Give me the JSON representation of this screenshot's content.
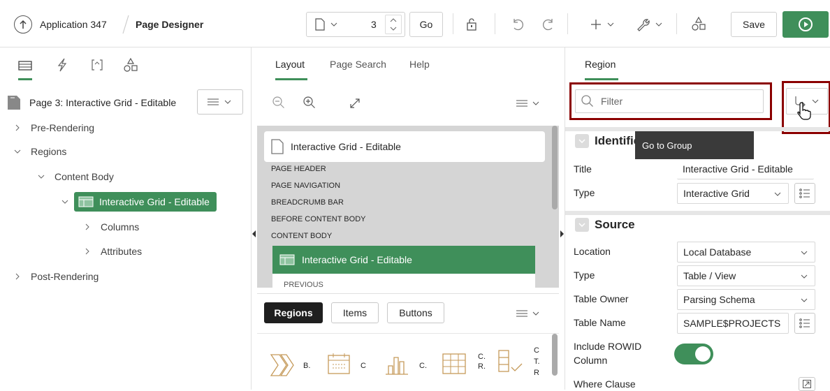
{
  "topbar": {
    "app_title": "Application 347",
    "page_title": "Page Designer",
    "page_number": "3",
    "go_label": "Go",
    "save_label": "Save"
  },
  "left": {
    "page_label": "Page 3: Interactive Grid - Editable",
    "tree": {
      "pre_rendering": "Pre-Rendering",
      "regions": "Regions",
      "content_body": "Content Body",
      "ig_region": "Interactive Grid - Editable",
      "columns": "Columns",
      "attributes": "Attributes",
      "post_rendering": "Post-Rendering"
    }
  },
  "middle": {
    "tabs": [
      "Layout",
      "Page Search",
      "Help"
    ],
    "page_card": "Interactive Grid - Editable",
    "positions": [
      "PAGE HEADER",
      "PAGE NAVIGATION",
      "BREADCRUMB BAR",
      "BEFORE CONTENT BODY",
      "CONTENT BODY"
    ],
    "region_block": "Interactive Grid - Editable",
    "previous_label": "PREVIOUS",
    "gallery_tabs": [
      "Regions",
      "Items",
      "Buttons"
    ],
    "gallery_labels": [
      "B.",
      "C",
      "C.",
      "C.\nR.",
      "C\nT.\nR"
    ]
  },
  "right": {
    "tab": "Region",
    "filter_placeholder": "Filter",
    "tooltip": "Go to Group",
    "identification_header": "Identific",
    "title_label": "Title",
    "title_value": "Interactive Grid - Editable",
    "type_label": "Type",
    "type_value": "Interactive Grid",
    "source_header": "Source",
    "location_label": "Location",
    "location_value": "Local Database",
    "source_type_label": "Type",
    "source_type_value": "Table / View",
    "table_owner_label": "Table Owner",
    "table_owner_value": "Parsing Schema",
    "table_name_label": "Table Name",
    "table_name_value": "SAMPLE$PROJECTS",
    "rowid_label_1": "Include ROWID",
    "rowid_label_2": "Column",
    "where_label": "Where Clause"
  },
  "colors": {
    "accent_green": "#3f8f5a",
    "highlight_red": "#8b0000",
    "tooltip_bg": "#3a3a3a",
    "panel_gray": "#e6e6e6"
  }
}
